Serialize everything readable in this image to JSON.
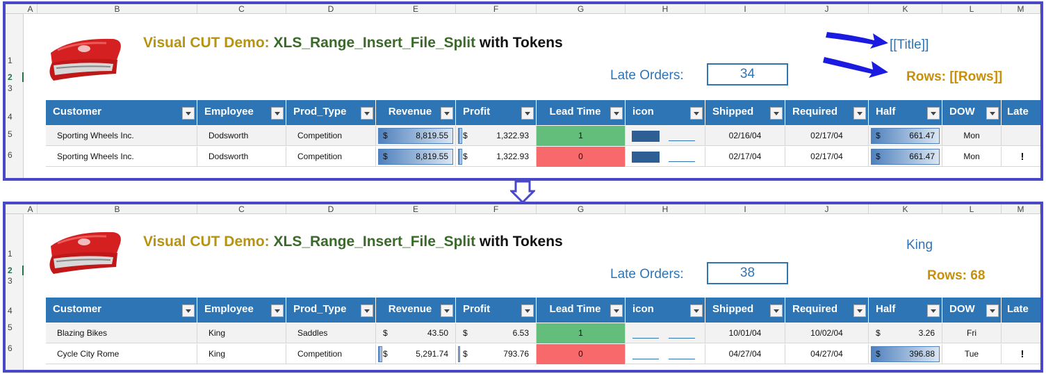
{
  "columns": [
    "A",
    "B",
    "C",
    "D",
    "E",
    "F",
    "G",
    "H",
    "I",
    "J",
    "K",
    "L",
    "M"
  ],
  "rows": [
    "1",
    "2",
    "3",
    "4",
    "5",
    "6"
  ],
  "title": {
    "part1": "Visual CUT Demo: ",
    "part2": "XLS_Range_Insert_File_Split",
    "part3": " with Tokens"
  },
  "late_orders_label": "Late Orders:",
  "headers": [
    "Customer",
    "Employee",
    "Prod_Type",
    "Revenue",
    "Profit",
    "Lead Time",
    "icon",
    "Shipped",
    "Required",
    "Half",
    "DOW",
    "Late"
  ],
  "currency_symbol": "$",
  "top": {
    "late_orders_value": "34",
    "title_token": "[[Title]]",
    "rows_token": "Rows: [[Rows]]",
    "data": [
      {
        "customer": "Sporting Wheels Inc.",
        "employee": "Dodsworth",
        "prod_type": "Competition",
        "revenue": "8,819.55",
        "profit": "1,322.93",
        "lead_time": "1",
        "shipped": "02/16/04",
        "required": "02/17/04",
        "half": "661.47",
        "dow": "Mon",
        "late": ""
      },
      {
        "customer": "Sporting Wheels Inc.",
        "employee": "Dodsworth",
        "prod_type": "Competition",
        "revenue": "8,819.55",
        "profit": "1,322.93",
        "lead_time": "0",
        "shipped": "02/17/04",
        "required": "02/17/04",
        "half": "661.47",
        "dow": "Mon",
        "late": "!"
      }
    ]
  },
  "bottom": {
    "late_orders_value": "38",
    "title_token": "King",
    "rows_token": "Rows: 68",
    "data": [
      {
        "customer": "Blazing Bikes",
        "employee": "King",
        "prod_type": "Saddles",
        "revenue": "43.50",
        "profit": "6.53",
        "lead_time": "1",
        "shipped": "10/01/04",
        "required": "10/02/04",
        "half": "3.26",
        "dow": "Fri",
        "late": ""
      },
      {
        "customer": "Cycle City Rome",
        "employee": "King",
        "prod_type": "Competition",
        "revenue": "5,291.74",
        "profit": "793.76",
        "lead_time": "0",
        "shipped": "04/27/04",
        "required": "04/27/04",
        "half": "396.88",
        "dow": "Tue",
        "late": "!"
      }
    ]
  },
  "colors": {
    "frame": "#4848c8",
    "header_blue": "#2e75b6",
    "title_gold": "#b8940e",
    "title_green": "#3a6a2a",
    "lead_green": "#63be7b",
    "lead_red": "#f8696b"
  }
}
